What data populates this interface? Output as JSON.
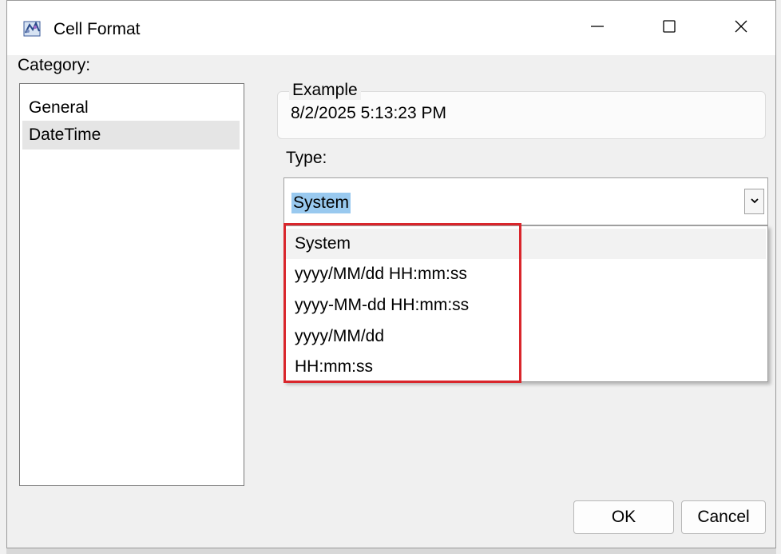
{
  "window": {
    "title": "Cell Format",
    "icons": {
      "app": "app-icon",
      "minimize": "minimize-icon",
      "maximize": "maximize-icon",
      "close": "close-icon"
    }
  },
  "category": {
    "label": "Category:",
    "items": [
      "General",
      "DateTime"
    ],
    "selected": "DateTime"
  },
  "example": {
    "label": "Example",
    "value": "8/2/2025 5:13:23 PM"
  },
  "type": {
    "label": "Type:",
    "value": "System",
    "options": [
      "System",
      "yyyy/MM/dd HH:mm:ss",
      "yyyy-MM-dd HH:mm:ss",
      "yyyy/MM/dd",
      "HH:mm:ss"
    ],
    "hovered": "System"
  },
  "buttons": {
    "ok": "OK",
    "cancel": "Cancel"
  },
  "colors": {
    "selection": "#99c9ef",
    "highlight_box": "#d9262c"
  }
}
